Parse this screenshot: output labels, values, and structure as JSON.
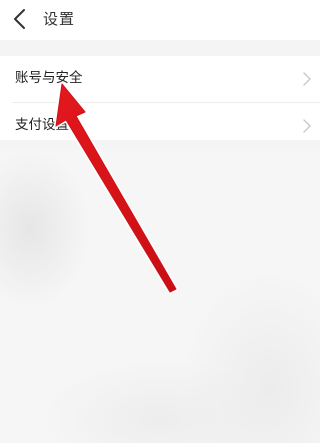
{
  "header": {
    "back_icon": "chevron-left-icon",
    "title": "设置"
  },
  "settings": {
    "items": [
      {
        "label": "账号与安全",
        "icon": "chevron-right-icon"
      },
      {
        "label": "支付设置",
        "icon": "chevron-right-icon"
      }
    ]
  },
  "colors": {
    "background": "#ffffff",
    "section_gap": "#f4f4f4",
    "text": "#222222",
    "chevron": "#c8c8c8",
    "annotation_arrow": "#e3181d"
  }
}
